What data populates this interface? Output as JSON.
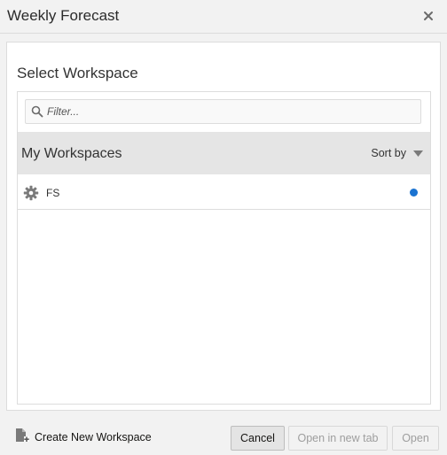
{
  "dialog": {
    "title": "Weekly Forecast",
    "close_icon": "close-icon"
  },
  "panel": {
    "heading": "Select Workspace",
    "filter": {
      "placeholder": "Filter...",
      "value": "",
      "icon": "search-icon"
    },
    "workspaces_header": {
      "title": "My Workspaces",
      "sort_label": "Sort by",
      "sort_icon": "caret-down-icon"
    },
    "workspaces": [
      {
        "name": "FS",
        "icon": "gear-icon",
        "status_color": "#1a73d1"
      }
    ]
  },
  "footer": {
    "create_label": "Create New Workspace",
    "create_icon": "new-document-icon",
    "cancel_label": "Cancel",
    "open_new_tab_label": "Open in new tab",
    "open_label": "Open"
  },
  "colors": {
    "accent": "#1a73d1",
    "header_bg": "#e5e5e5",
    "dialog_bg": "#f2f2f2"
  }
}
